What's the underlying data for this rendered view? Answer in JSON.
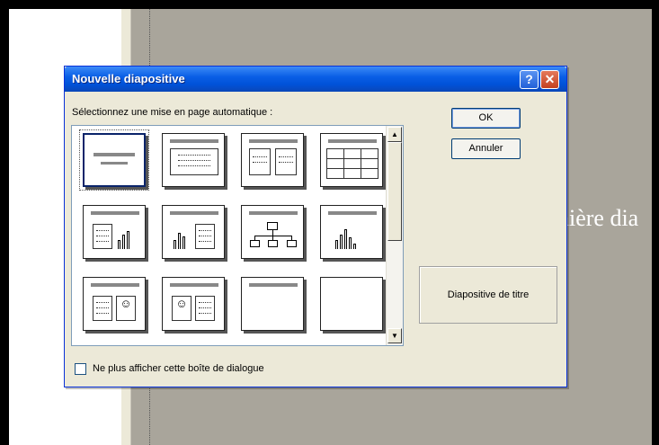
{
  "slide": {
    "title_text": "nière dia"
  },
  "dialog": {
    "title": "Nouvelle diapositive",
    "help_label": "?",
    "close_label": "✕",
    "instruction": "Sélectionnez une mise en page automatique :",
    "ok_label": "OK",
    "cancel_label": "Annuler",
    "preview_label": "Diapositive de titre",
    "checkbox_label": "Ne plus afficher cette boîte de dialogue",
    "checkbox_checked": false,
    "selected_layout": "Diapositive de titre"
  },
  "scrollbar": {
    "up_icon": "▲",
    "down_icon": "▼"
  },
  "figure_icon": "☺",
  "icons": [
    "help-icon",
    "close-icon",
    "scroll-up-icon",
    "scroll-down-icon",
    "checkbox-icon"
  ]
}
